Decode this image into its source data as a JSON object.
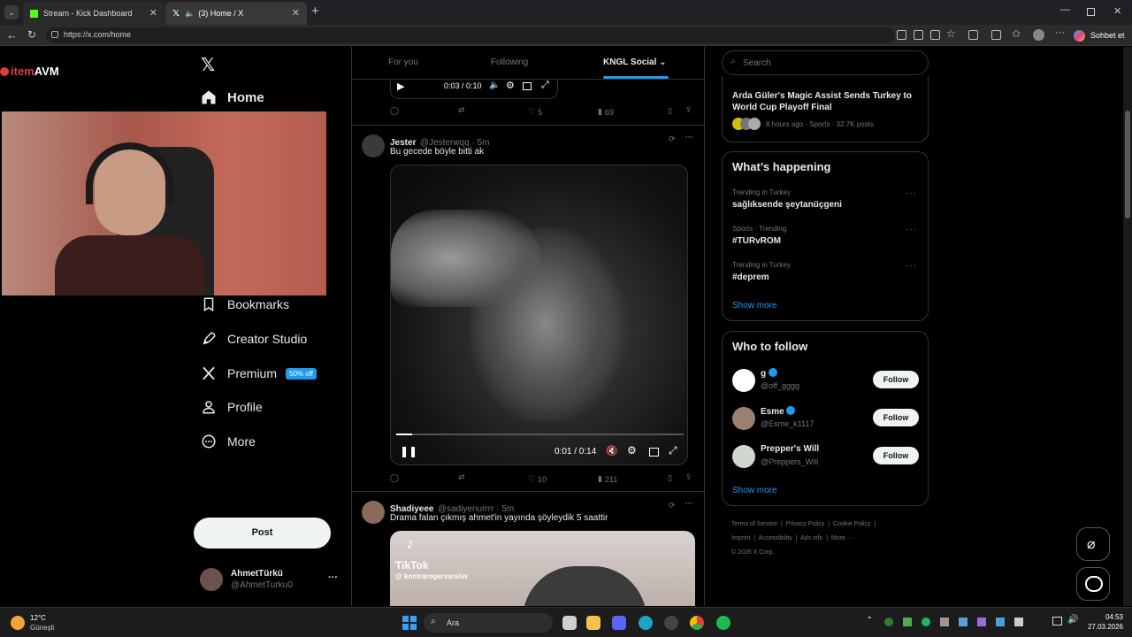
{
  "browser": {
    "tabs": [
      {
        "title": "Stream - Kick Dashboard"
      },
      {
        "title": "(3) Home / X"
      }
    ],
    "url": "https://x.com/home",
    "profile_button": "Sohbet et"
  },
  "overlay": {
    "logo_item": "item",
    "logo_avm": "AVM"
  },
  "nav": {
    "home": "Home",
    "bookmarks": "Bookmarks",
    "creator_studio": "Creator Studio",
    "premium": "Premium",
    "premium_badge": "50% off",
    "profile": "Profile",
    "more": "More",
    "post": "Post"
  },
  "account": {
    "name": "AhmetTürkü",
    "handle": "@AhmetTurku0",
    "menu": "···"
  },
  "feed": {
    "tabs": [
      "For you",
      "Following",
      "KNGL Social"
    ],
    "top_video": {
      "time": "0:03 / 0:10"
    },
    "top_actions": {
      "likes": "5",
      "views": "69"
    },
    "tweet1": {
      "name": "Jester",
      "handle": "@Jesterwqq · 5m",
      "text": "Bu gecede böyle bitti ak",
      "video_time": "0:01 / 0:14",
      "likes": "10",
      "views": "211"
    },
    "tweet2": {
      "name": "Shadiyeee",
      "handle": "@sadiyenurrrr · 5m",
      "text": "Drama falan çıkmış ahmet'in yayında şöyleydik 5 saattir",
      "tiktok": "TikTok",
      "tiktok_user": "@ kontrarogersarsivv"
    }
  },
  "sidebar": {
    "search_placeholder": "Search",
    "news": {
      "title": "Arda Güler's Magic Assist Sends Turkey to World Cup Playoff Final",
      "meta": "8 hours ago · Sports · 32.7K posts"
    },
    "happening": {
      "title": "What’s happening",
      "trends": [
        {
          "context": "Trending in Turkey",
          "name": "sağlıksende şeytanüçgeni"
        },
        {
          "context": "Sports · Trending",
          "name": "#TURvROM"
        },
        {
          "context": "Trending in Turkey",
          "name": "#deprem"
        }
      ],
      "show_more": "Show more"
    },
    "who": {
      "title": "Who to follow",
      "users": [
        {
          "name": "g",
          "handle": "@off_gggg"
        },
        {
          "name": "Esme",
          "handle": "@Esme_k1117"
        },
        {
          "name": "Prepper's Will",
          "handle": "@Preppers_Will"
        }
      ],
      "follow": "Follow",
      "show_more": "Show more"
    },
    "footer": {
      "line1": [
        "Terms of Service",
        "Privacy Policy",
        "Cookie Policy"
      ],
      "line2": [
        "Imprint",
        "Accessibility",
        "Ads info",
        "More ···"
      ],
      "copyright": "© 2026 X Corp."
    }
  },
  "taskbar": {
    "temp": "12°C",
    "weather": "Güneşli",
    "search": "Ara",
    "time": "04:53",
    "date": "27.03.2026"
  }
}
